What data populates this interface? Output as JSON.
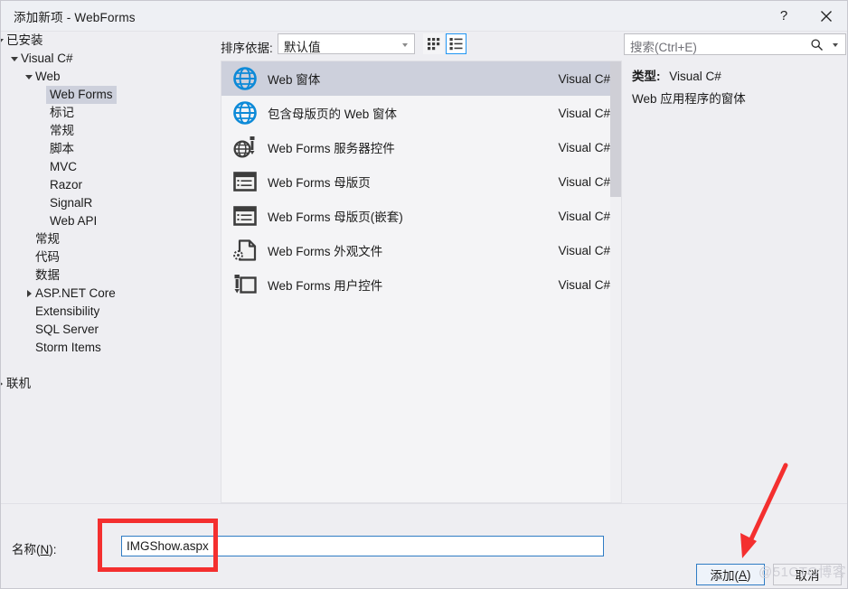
{
  "window": {
    "title": "添加新项 - WebForms",
    "help_icon": "help-icon",
    "help_label": "?",
    "close_icon": "close-icon"
  },
  "sidebar": {
    "items": [
      {
        "label": "已安装",
        "indent": 0,
        "arrow": "open",
        "selected": false
      },
      {
        "label": "Visual C#",
        "indent": 1,
        "arrow": "open",
        "selected": false
      },
      {
        "label": "Web",
        "indent": 2,
        "arrow": "open",
        "selected": false
      },
      {
        "label": "Web Forms",
        "indent": 3,
        "arrow": "none",
        "selected": true
      },
      {
        "label": "标记",
        "indent": 3,
        "arrow": "none",
        "selected": false
      },
      {
        "label": "常规",
        "indent": 3,
        "arrow": "none",
        "selected": false
      },
      {
        "label": "脚本",
        "indent": 3,
        "arrow": "none",
        "selected": false
      },
      {
        "label": "MVC",
        "indent": 3,
        "arrow": "none",
        "selected": false
      },
      {
        "label": "Razor",
        "indent": 3,
        "arrow": "none",
        "selected": false
      },
      {
        "label": "SignalR",
        "indent": 3,
        "arrow": "none",
        "selected": false
      },
      {
        "label": "Web API",
        "indent": 3,
        "arrow": "none",
        "selected": false
      },
      {
        "label": "常规",
        "indent": 2,
        "arrow": "none",
        "selected": false
      },
      {
        "label": "代码",
        "indent": 2,
        "arrow": "none",
        "selected": false
      },
      {
        "label": "数据",
        "indent": 2,
        "arrow": "none",
        "selected": false
      },
      {
        "label": "ASP.NET Core",
        "indent": 2,
        "arrow": "closed",
        "selected": false
      },
      {
        "label": "Extensibility",
        "indent": 2,
        "arrow": "none",
        "selected": false
      },
      {
        "label": "SQL Server",
        "indent": 2,
        "arrow": "none",
        "selected": false
      },
      {
        "label": "Storm Items",
        "indent": 2,
        "arrow": "none",
        "selected": false
      },
      {
        "label": "",
        "indent": 0,
        "arrow": "none",
        "selected": false
      },
      {
        "label": "联机",
        "indent": 0,
        "arrow": "closed",
        "selected": false
      }
    ]
  },
  "toolbar": {
    "sort_label": "排序依据:",
    "sort_value": "默认值",
    "tiles_view_icon": "tiles-view-icon",
    "list_view_icon": "list-view-icon"
  },
  "search": {
    "placeholder": "搜索(Ctrl+E)",
    "value": "搜索(Ctrl+E)",
    "icon": "search-icon"
  },
  "templates": {
    "items": [
      {
        "name": "Web 窗体",
        "lang": "Visual C#",
        "icon": "globe-icon",
        "selected": true
      },
      {
        "name": "包含母版页的 Web 窗体",
        "lang": "Visual C#",
        "icon": "globe-icon",
        "selected": false
      },
      {
        "name": "Web Forms 服务器控件",
        "lang": "Visual C#",
        "icon": "globe-control-icon",
        "selected": false
      },
      {
        "name": "Web Forms 母版页",
        "lang": "Visual C#",
        "icon": "master-page-icon",
        "selected": false
      },
      {
        "name": "Web Forms 母版页(嵌套)",
        "lang": "Visual C#",
        "icon": "master-page-icon",
        "selected": false
      },
      {
        "name": "Web Forms 外观文件",
        "lang": "Visual C#",
        "icon": "skin-file-icon",
        "selected": false
      },
      {
        "name": "Web Forms 用户控件",
        "lang": "Visual C#",
        "icon": "user-control-icon",
        "selected": false
      }
    ]
  },
  "info": {
    "type_label": "类型:",
    "type_value": "Visual C#",
    "description": "Web 应用程序的窗体"
  },
  "footer": {
    "name_label_prefix": "名称(",
    "name_label_key": "N",
    "name_label_suffix": "):",
    "name_value": "IMGShow.aspx",
    "add_prefix": "添加(",
    "add_key": "A",
    "add_suffix": ")",
    "cancel_label": "取消"
  },
  "annotations": {
    "watermark": "@51CTO博客",
    "highlight_color": "#f42f2f",
    "arrow_color": "#f42f2f"
  },
  "colors": {
    "dialog_background": "#eeeef2",
    "list_background": "#f4f4f6",
    "selection": "#cdd0dc",
    "accent_blue": "#2f7cc4",
    "icon_blue": "#0d8ad8",
    "icon_dark": "#3d3d3d"
  }
}
